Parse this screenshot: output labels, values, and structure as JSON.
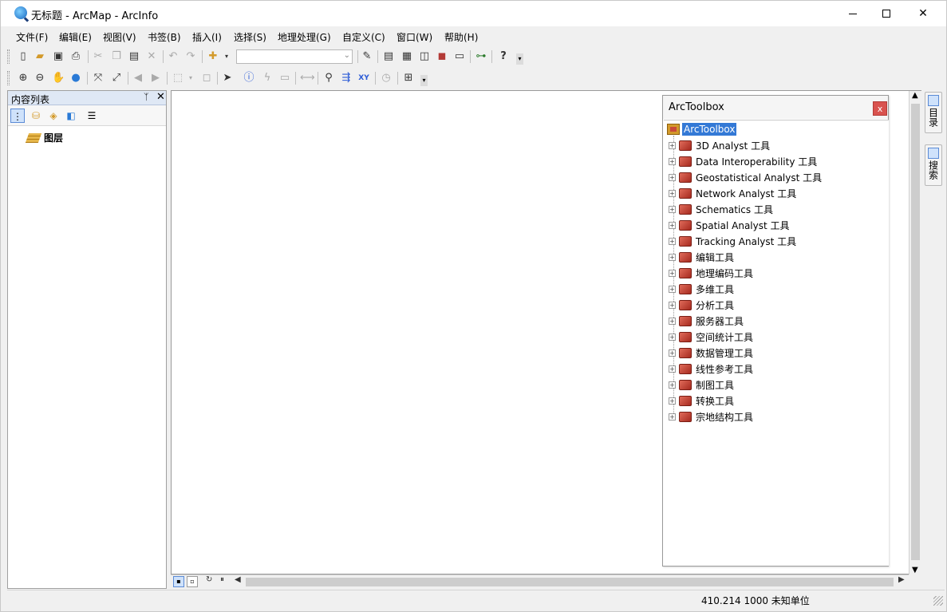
{
  "window": {
    "title": "无标题 - ArcMap - ArcInfo",
    "minimize_glyph": "",
    "maximize_glyph": "",
    "close_glyph": "✕"
  },
  "menu": [
    "文件(F)",
    "编辑(E)",
    "视图(V)",
    "书签(B)",
    "插入(I)",
    "选择(S)",
    "地理处理(G)",
    "自定义(C)",
    "窗口(W)",
    "帮助(H)"
  ],
  "toolbar1": {
    "icons": [
      "new-document-icon",
      "open-folder-icon",
      "save-icon",
      "print-icon",
      "cut-icon",
      "copy-icon",
      "paste-icon",
      "delete-icon",
      "undo-icon",
      "redo-icon",
      "add-data-icon"
    ],
    "scale_value": "",
    "right_icons": [
      "editor-toolbar-icon",
      "toc-window-icon",
      "catalog-window-icon",
      "search-window-icon",
      "arctoolbox-icon",
      "python-icon",
      "model-builder-icon",
      "whats-this-icon"
    ]
  },
  "toolbar2": {
    "icons": [
      "zoom-in-icon",
      "zoom-out-icon",
      "pan-icon",
      "full-extent-icon",
      "fixed-zoom-in-icon",
      "fixed-zoom-out-icon",
      "back-icon",
      "forward-icon",
      "select-features-icon",
      "clear-selection-icon",
      "select-elements-icon",
      "identify-icon",
      "hyperlink-icon",
      "html-popup-icon",
      "measure-icon",
      "find-icon",
      "find-route-icon",
      "go-to-xy-icon",
      "time-slider-icon",
      "magnifier-icon"
    ]
  },
  "toc": {
    "title": "内容列表",
    "pin_glyph": "ᛉ",
    "close_glyph": "✕",
    "layers_label": "图层"
  },
  "arctoolbox": {
    "title": "ArcToolbox",
    "close_glyph": "x",
    "root_label": "ArcToolbox",
    "items": [
      "3D Analyst 工具",
      "Data Interoperability 工具",
      "Geostatistical Analyst 工具",
      "Network Analyst 工具",
      "Schematics 工具",
      "Spatial Analyst 工具",
      "Tracking Analyst 工具",
      "编辑工具",
      "地理编码工具",
      "多维工具",
      "分析工具",
      "服务器工具",
      "空间统计工具",
      "数据管理工具",
      "线性参考工具",
      "制图工具",
      "转换工具",
      "宗地结构工具"
    ]
  },
  "side_tabs": {
    "catalog": "目录",
    "search": "搜索"
  },
  "status": {
    "coordinates": "410.214  1000 未知单位"
  },
  "colors": {
    "selection": "#3379d6",
    "toolbox_close": "#d9534f"
  }
}
